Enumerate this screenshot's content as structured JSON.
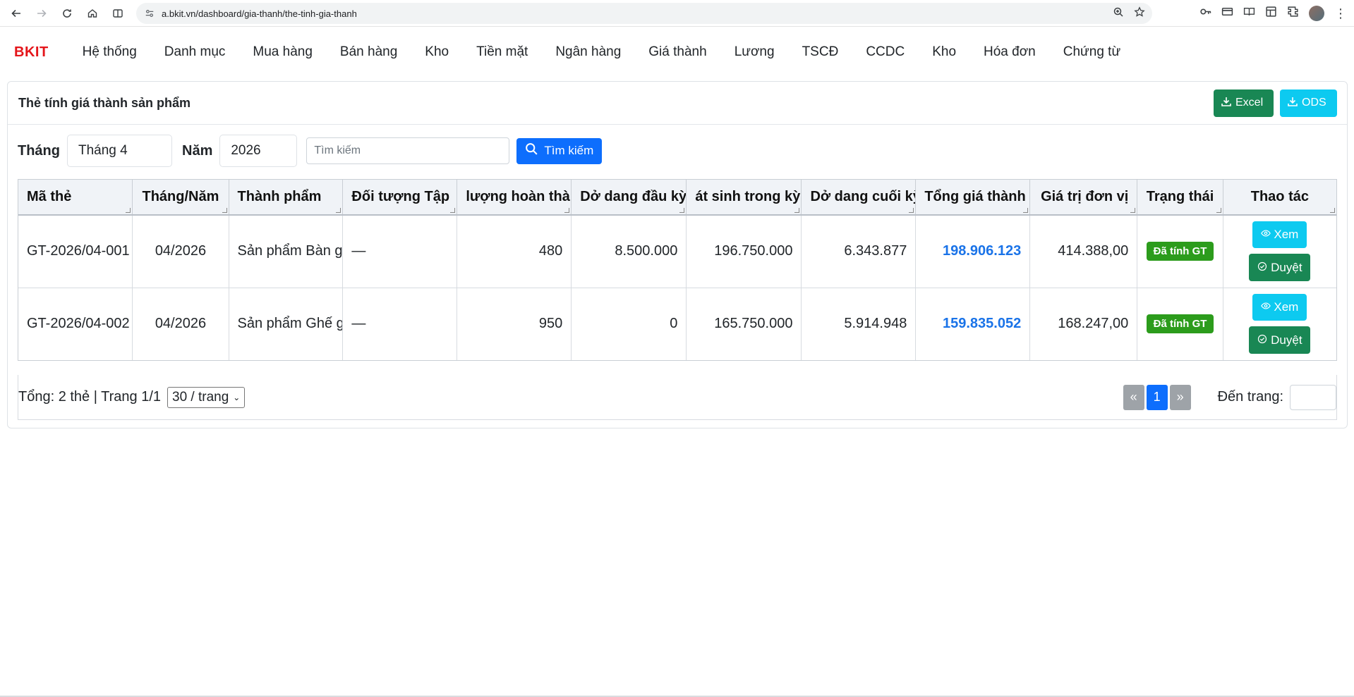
{
  "browser": {
    "url": "a.bkit.vn/dashboard/gia-thanh/the-tinh-gia-thanh"
  },
  "app": {
    "brand": "BKIT",
    "menu": [
      "Hệ thống",
      "Danh mục",
      "Mua hàng",
      "Bán hàng",
      "Kho",
      "Tiền mặt",
      "Ngân hàng",
      "Giá thành",
      "Lương",
      "TSCĐ",
      "CCDC",
      "Kho",
      "Hóa đơn",
      "Chứng từ"
    ]
  },
  "card": {
    "title": "Thẻ tính giá thành sản phẩm",
    "excel_label": "Excel",
    "ods_label": "ODS"
  },
  "filters": {
    "month_label": "Tháng",
    "month_value": "Tháng 4",
    "year_label": "Năm",
    "year_value": "2026",
    "search_placeholder": "Tìm kiếm",
    "search_button": "Tìm kiếm"
  },
  "table": {
    "headers": [
      "Mã thẻ",
      "Tháng/Năm",
      "Thành phẩm",
      "Đối tượng Tập",
      "lượng hoàn thành",
      "Dở dang đầu kỳ",
      "át sinh trong kỳ",
      "Dở dang cuối kỳ",
      "Tổng giá thành",
      "Giá trị đơn vị",
      "Trạng thái",
      "Thao tác"
    ],
    "rows": [
      {
        "code": "GT-2026/04-001",
        "period": "04/2026",
        "product": "Sản phẩm Bàn g",
        "object": "—",
        "qty": "480",
        "wip_begin": "8.500.000",
        "incurred": "196.750.000",
        "wip_end": "6.343.877",
        "total": "198.906.123",
        "unit": "414.388,00",
        "status": "Đã tính GT",
        "view": "Xem",
        "approve": "Duyệt"
      },
      {
        "code": "GT-2026/04-002",
        "period": "04/2026",
        "product": "Sản phẩm Ghế g",
        "object": "—",
        "qty": "950",
        "wip_begin": "0",
        "incurred": "165.750.000",
        "wip_end": "5.914.948",
        "total": "159.835.052",
        "unit": "168.247,00",
        "status": "Đã tính GT",
        "view": "Xem",
        "approve": "Duyệt"
      }
    ]
  },
  "footer": {
    "summary": "Tổng: 2 thẻ | Trang 1/1",
    "per_page": "30 / trang",
    "prev": "«",
    "page": "1",
    "next": "»",
    "goto_label": "Đến trang:"
  },
  "colors": {
    "brand": "#e4151a",
    "primary": "#0d6efd",
    "success": "#198754",
    "info": "#0dcaf0",
    "status_badge": "#2c9c1c",
    "total_text": "#1a73e8"
  }
}
